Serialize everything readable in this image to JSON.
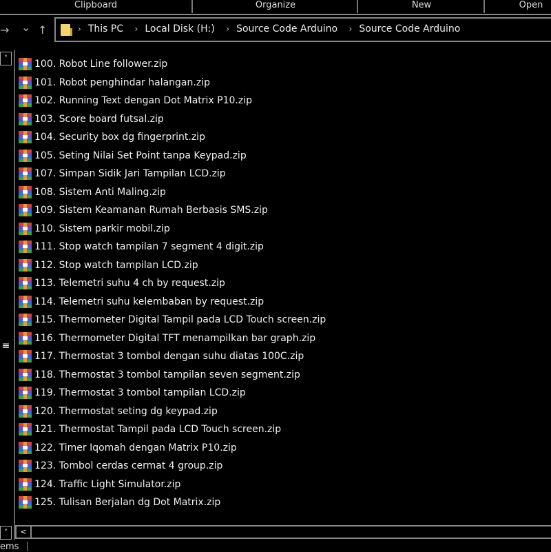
{
  "ribbon": {
    "groups": [
      "Clipboard",
      "Organize",
      "New",
      "Open"
    ]
  },
  "nav": {
    "forward_icon": "→",
    "recent_icon": "⌄",
    "up_icon": "↑"
  },
  "address": {
    "crumbs": [
      "This PC",
      "Local Disk (H:)",
      "Source Code Arduino",
      "Source Code Arduino"
    ]
  },
  "files": [
    "100. Robot Line follower.zip",
    "101. Robot penghindar halangan.zip",
    "102. Running Text dengan Dot Matrix P10.zip",
    "103. Score board futsal.zip",
    "104. Security box dg fingerprint.zip",
    "105. Seting Nilai Set Point tanpa Keypad.zip",
    "107. Simpan Sidik Jari Tampilan LCD.zip",
    "108. Sistem Anti Maling.zip",
    "109. Sistem Keamanan Rumah Berbasis SMS.zip",
    "110. Sistem parkir mobil.zip",
    "111. Stop watch tampilan 7 segment 4 digit.zip",
    "112. Stop watch tampilan LCD.zip",
    "113. Telemetri suhu 4 ch by request.zip",
    "114. Telemetri suhu kelembaban by request.zip",
    "115. Thermometer Digital Tampil pada LCD Touch screen.zip",
    "116. Thermometer Digital TFT menampilkan bar graph.zip",
    "117. Thermostat 3 tombol dengan suhu diatas 100C.zip",
    "118. Thermostat 3 tombol tampilan seven segment.zip",
    "119. Thermostat 3 tombol tampilan LCD.zip",
    "120. Thermostat seting dg keypad.zip",
    "121. Thermostat Tampil pada LCD Touch screen.zip",
    "122. Timer Iqomah dengan Matrix P10.zip",
    "123. Tombol cerdas cermat 4 group.zip",
    "124. Traffic Light Simulator.zip",
    "125. Tulisan Berjalan dg Dot Matrix.zip"
  ],
  "status": {
    "text": "ems"
  }
}
